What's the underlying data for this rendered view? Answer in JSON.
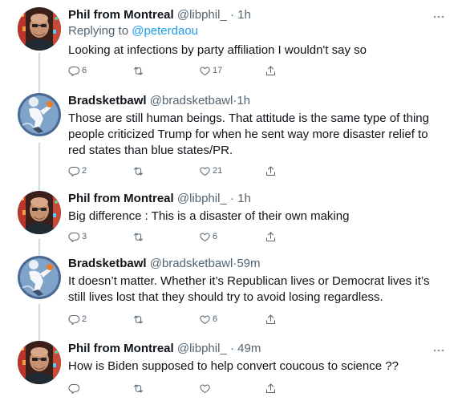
{
  "tweets": [
    {
      "name": "Phil from Montreal",
      "handle": "@libphil_",
      "dot": "·",
      "time": "1h",
      "reply_prefix": "Replying to",
      "reply_to": "@peterdaou",
      "text": "Looking at infections by party affiliation I wouldn't say so",
      "replies": "6",
      "retweets": "",
      "likes": "17",
      "avatar": "bald-man-avatar"
    },
    {
      "name": "Bradsketbawl",
      "handle": "@bradsketbawl",
      "dot": "·",
      "time": "1h",
      "text": "Those are still human beings. That attitude is the same type of thing people criticized Trump for when he sent way more disaster relief to red states than blue states/PR.",
      "replies": "2",
      "retweets": "",
      "likes": "21",
      "avatar": "basketball-player-avatar"
    },
    {
      "name": "Phil from Montreal",
      "handle": "@libphil_",
      "dot": "·",
      "time": "1h",
      "text": "Big difference : This is a disaster of their own making",
      "replies": "3",
      "retweets": "",
      "likes": "6",
      "avatar": "bald-man-avatar"
    },
    {
      "name": "Bradsketbawl",
      "handle": "@bradsketbawl",
      "dot": "·",
      "time": "59m",
      "text": "It doesn’t matter. Whether it’s Republican lives or Democrat lives it’s still lives lost that they should try to avoid losing regardless.",
      "replies": "2",
      "retweets": "",
      "likes": "6",
      "avatar": "basketball-player-avatar"
    },
    {
      "name": "Phil from Montreal",
      "handle": "@libphil_",
      "dot": "·",
      "time": "49m",
      "text": "How is Biden supposed to help convert coucous to science ??",
      "replies": "",
      "retweets": "",
      "likes": "",
      "avatar": "bald-man-avatar"
    }
  ],
  "colors": {
    "text": "#0f1419",
    "secondary": "#536471",
    "link": "#1d9bf0",
    "thread_line": "#cfd9de"
  },
  "icons": {
    "reply": "reply-icon",
    "retweet": "retweet-icon",
    "like": "like-icon",
    "share": "share-icon",
    "more": "more-icon"
  }
}
